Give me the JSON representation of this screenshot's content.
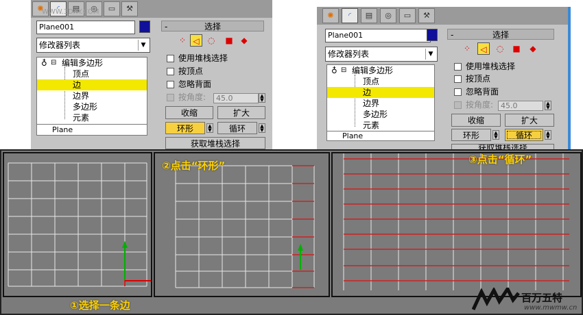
{
  "watermark_top": "WWW.3DXY.COM",
  "panel": {
    "name_field": "Plane001",
    "modifier_list": "修改器列表",
    "stack": {
      "root": "编辑多边形",
      "items": [
        "顶点",
        "边",
        "边界",
        "多边形",
        "元素"
      ],
      "selected_index": 1,
      "base": "Plane"
    },
    "selection": {
      "title": "选择",
      "minus": "-",
      "checkboxes": {
        "use_stack": "使用堆栈选择",
        "by_vertex": "按顶点",
        "ignore_back": "忽略背面",
        "by_angle": "按角度:"
      },
      "angle_value": "45.0",
      "buttons": {
        "shrink": "收缩",
        "grow": "扩大",
        "ring": "环形",
        "loop": "循环",
        "get_stack": "获取堆栈选择"
      }
    }
  },
  "captions": {
    "step1": "①选择一条边",
    "step2": "②点击“环形”",
    "step3": "③点击“循环”"
  },
  "logo": {
    "brand": "百万五特",
    "url": "www.mwmw.cn"
  },
  "colors": {
    "viewport_bg": "#7b7b7b",
    "grid_line": "#e8e8e8",
    "selected_edge": "#cc2222",
    "caption": "#ffd200",
    "highlight": "#f3e800"
  }
}
